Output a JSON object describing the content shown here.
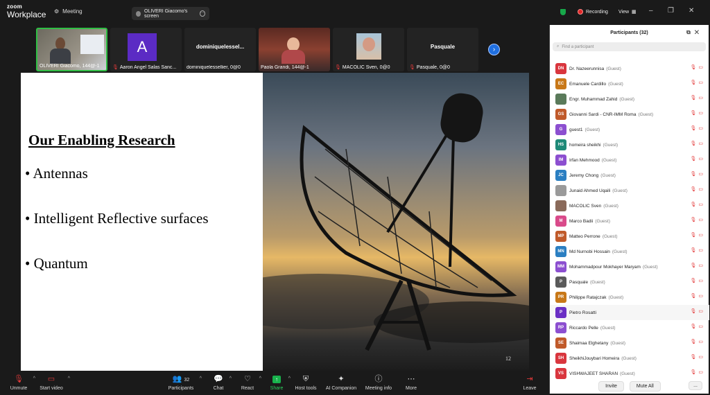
{
  "titlebar": {
    "logo_top": "zoom",
    "logo_bottom": "Workplace",
    "meeting_label": "Meeting",
    "screen_pill": "OLIVERI Giacomo's screen",
    "recording_label": "Recording",
    "view_label": "View",
    "minimize": "–",
    "restore": "❐",
    "close": "✕"
  },
  "strip": {
    "tiles": [
      {
        "name": "OLIVERI Giacomo, 144@-1",
        "center": "",
        "avatar": ""
      },
      {
        "name": "Aaron Angel Salas Sanc...",
        "center": "",
        "avatar": "A"
      },
      {
        "name": "dominiquelessellier, 0@0",
        "center": "dominiquelessel...",
        "avatar": ""
      },
      {
        "name": "Paola Grandi, 144@-1",
        "center": "",
        "avatar": ""
      },
      {
        "name": "MACOLIC Sven, 0@0",
        "center": "",
        "avatar": ""
      },
      {
        "name": "Pasquale, 0@0",
        "center": "Pasquale",
        "avatar": ""
      }
    ],
    "next_icon": "›"
  },
  "slide": {
    "title": "Our Enabling  Research",
    "bullets": [
      "• Antennas",
      "• Intelligent Reflective surfaces",
      "• Quantum"
    ],
    "page_number": "12"
  },
  "toolbar": {
    "unmute": "Unmute",
    "start_video": "Start video",
    "participants": "Participants",
    "participants_count": "32",
    "chat": "Chat",
    "react": "React",
    "share": "Share",
    "host_tools": "Host tools",
    "ai_companion": "AI Companion",
    "meeting_info": "Meeting info",
    "more": "More",
    "leave": "Leave"
  },
  "panel": {
    "title": "Participants (32)",
    "search_placeholder": "Find a participant",
    "invite": "Invite",
    "mute_all": "Mute All",
    "more": "...",
    "participants": [
      {
        "initials": "DN",
        "name": "Dr. Nazeerunnisa",
        "role": "(Guest)",
        "color": "#d9363e"
      },
      {
        "initials": "EC",
        "name": "Emanuele Cardillo",
        "role": "(Guest)",
        "color": "#c87818"
      },
      {
        "initials": "",
        "name": "Engr. Muhammad Zahid",
        "role": "(Guest)",
        "color": "#5a7a5a"
      },
      {
        "initials": "GS",
        "name": "Giovanni Sardi - CNR-IMM Roma",
        "role": "(Guest)",
        "color": "#c05a2a"
      },
      {
        "initials": "G",
        "name": "guest1",
        "role": "(Guest)",
        "color": "#8c4fd0"
      },
      {
        "initials": "HS",
        "name": "homeira sheikhi",
        "role": "(Guest)",
        "color": "#1f8a78"
      },
      {
        "initials": "IM",
        "name": "Irfan Mehmood",
        "role": "(Guest)",
        "color": "#8c4fd0"
      },
      {
        "initials": "JC",
        "name": "Jeremy Chong",
        "role": "(Guest)",
        "color": "#2b7fc2"
      },
      {
        "initials": "",
        "name": "Junaid Ahmed Uqaili",
        "role": "(Guest)",
        "color": "#9a9a9a"
      },
      {
        "initials": "",
        "name": "MACOLIC Sven",
        "role": "(Guest)",
        "color": "#8a6a5a"
      },
      {
        "initials": "M",
        "name": "Marco Badii",
        "role": "(Guest)",
        "color": "#d94a8a"
      },
      {
        "initials": "MP",
        "name": "Matteo Perrone",
        "role": "(Guest)",
        "color": "#c05a2a"
      },
      {
        "initials": "MN",
        "name": "Md Nurnobi Hossain",
        "role": "(Guest)",
        "color": "#2b7fc2"
      },
      {
        "initials": "MM",
        "name": "Mohammadpour Mokhayer Maryam",
        "role": "(Guest)",
        "color": "#8c4fd0"
      },
      {
        "initials": "P",
        "name": "Pasquale",
        "role": "(Guest)",
        "color": "#5a5a5a"
      },
      {
        "initials": "PR",
        "name": "Philippe Ratajczak",
        "role": "(Guest)",
        "color": "#c87818"
      },
      {
        "initials": "P",
        "name": "Pietro Rosatti",
        "role": "",
        "color": "#6a2fc4"
      },
      {
        "initials": "RP",
        "name": "Riccardo Pelle",
        "role": "(Guest)",
        "color": "#8c4fd0"
      },
      {
        "initials": "SE",
        "name": "Shaimaa Elghetany",
        "role": "(Guest)",
        "color": "#c05a2a"
      },
      {
        "initials": "SH",
        "name": "SheikhiJouybari Homeira",
        "role": "(Guest)",
        "color": "#d9363e"
      },
      {
        "initials": "VS",
        "name": "VISHWAJEET SHARAN",
        "role": "(Guest)",
        "color": "#d9363e"
      }
    ]
  }
}
